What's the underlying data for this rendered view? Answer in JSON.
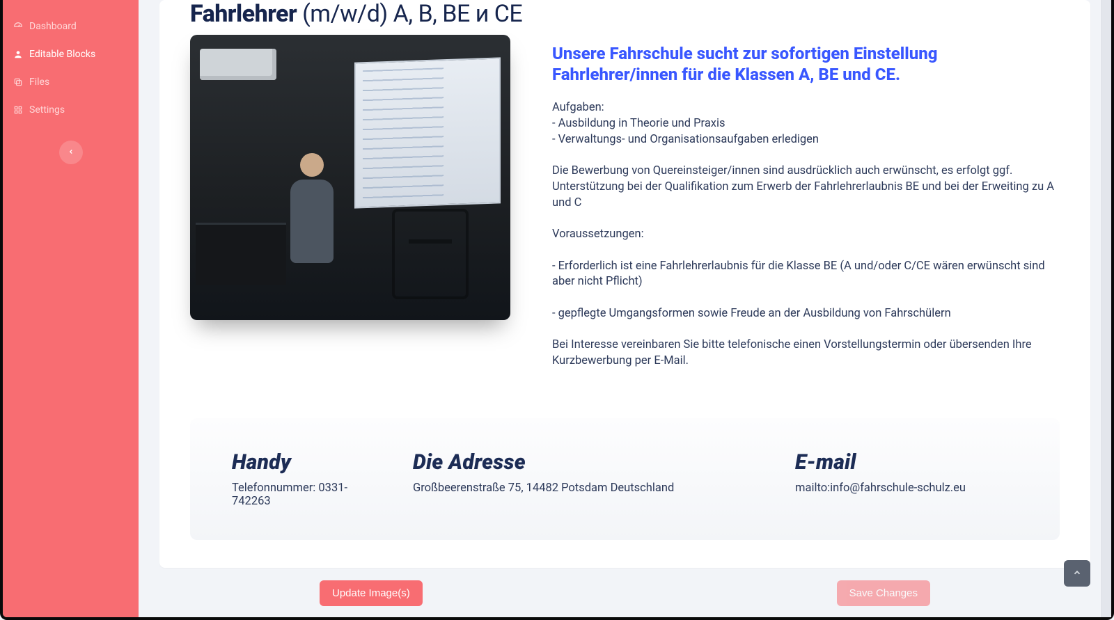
{
  "sidebar": {
    "items": [
      {
        "label": "Dashboard",
        "icon": "gauge-icon",
        "active": false
      },
      {
        "label": "Editable Blocks",
        "icon": "user-icon",
        "active": true
      },
      {
        "label": "Files",
        "icon": "copy-icon",
        "active": false
      },
      {
        "label": "Settings",
        "icon": "grid-icon",
        "active": false
      }
    ]
  },
  "page": {
    "title_bold": "Fahrlehrer",
    "title_light": "(m/w/d) A, B, BE и CE"
  },
  "job": {
    "headline": "Unsere Fahrschule sucht zur sofortigen Einstellung Fahrlehrer/innen für die Klassen A, BE und CE.",
    "body": "Aufgaben:\n- Ausbildung in Theorie und Praxis\n- Verwaltungs- und Organisationsaufgaben erledigen\n\nDie Bewerbung von Quereinsteiger/innen sind ausdrücklich auch erwünscht, es erfolgt ggf. Unterstützung bei der Qualifikation zum Erwerb der Fahrlehrerlaubnis BE und bei der Erweiting zu A und C\n\nVoraussetzungen:\n\n- Erforderlich ist eine Fahrlehrerlaubnis für die Klasse BE (A und/oder C/CE wären erwünscht sind aber nicht Pflicht)\n\n- gepflegte Umgangsformen sowie Freude an der Ausbildung von Fahrschülern\n\nBei Interesse vereinbaren Sie bitte telefonische einen Vorstellungstermin oder übersenden Ihre Kurzbewerbung per E-Mail."
  },
  "contact": {
    "phone": {
      "title": "Handy",
      "value": "Telefonnummer: 0331-742263"
    },
    "address": {
      "title": "Die Adresse",
      "value": "Großbeerenstraße 75, 14482 Potsdam Deutschland"
    },
    "email": {
      "title": "E-mail",
      "value": "mailto:info@fahrschule-schulz.eu"
    }
  },
  "actions": {
    "update_images": "Update Image(s)",
    "save_changes": "Save Changes"
  }
}
